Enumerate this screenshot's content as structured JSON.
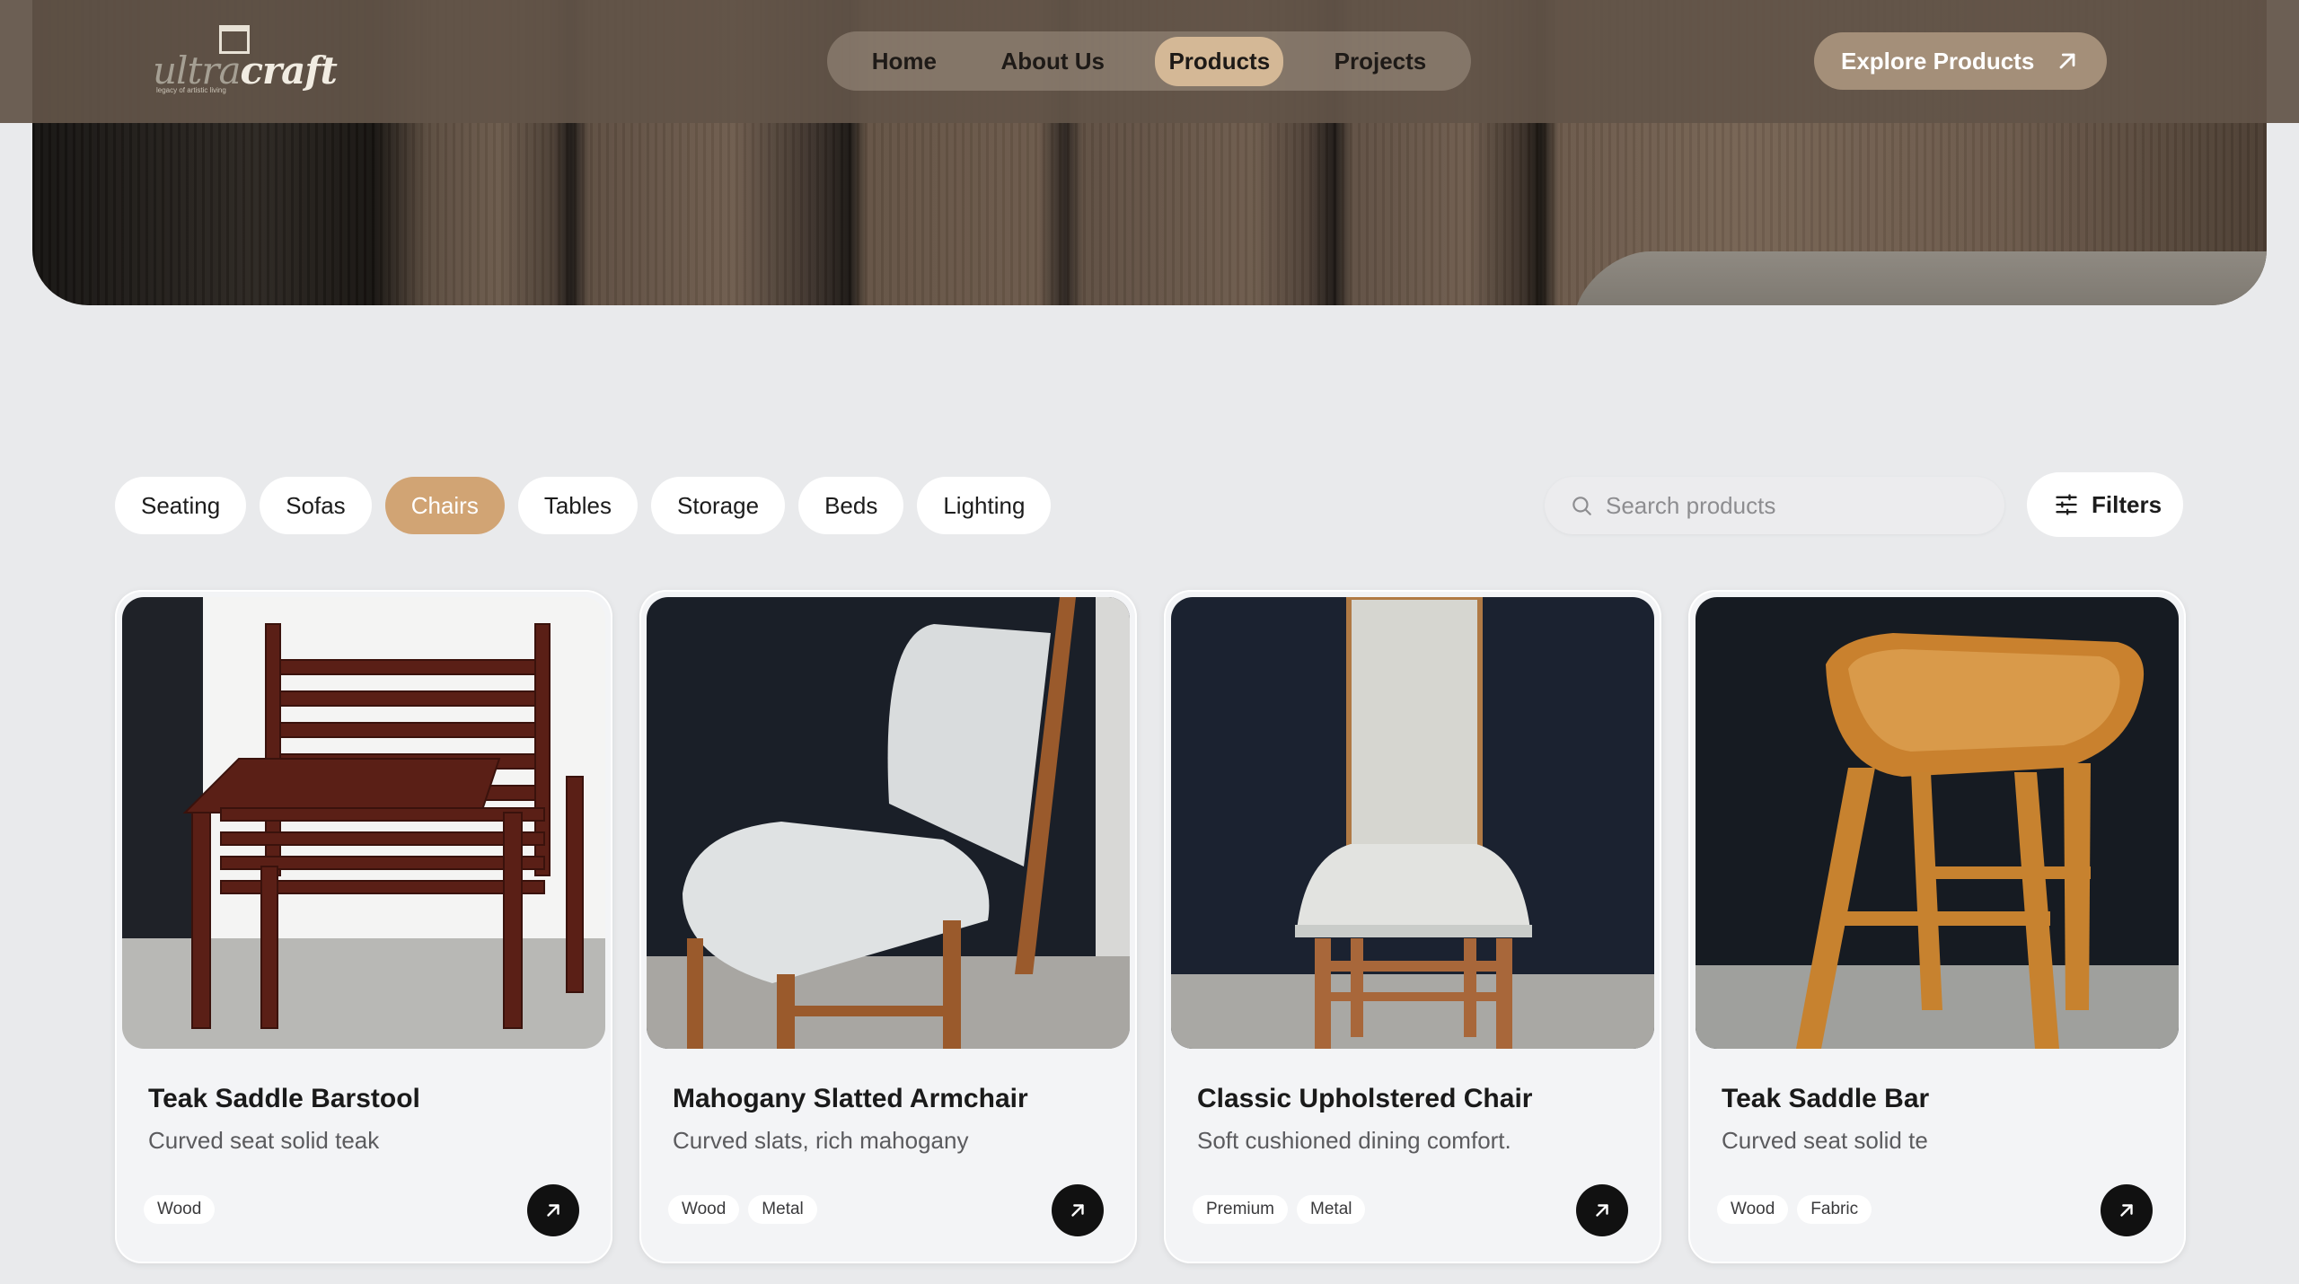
{
  "brand": {
    "logo_text_light": "ultra",
    "logo_text_bold": "craft",
    "logo_tagline": "legacy of artistic living"
  },
  "nav": {
    "items": [
      {
        "label": "Home",
        "active": false
      },
      {
        "label": "About Us",
        "active": false
      },
      {
        "label": "Products",
        "active": true
      },
      {
        "label": "Projects",
        "active": false
      }
    ],
    "cta_label": "Explore Products"
  },
  "categories": [
    {
      "label": "Seating",
      "active": false
    },
    {
      "label": "Sofas",
      "active": false
    },
    {
      "label": "Chairs",
      "active": true
    },
    {
      "label": "Tables",
      "active": false
    },
    {
      "label": "Storage",
      "active": false
    },
    {
      "label": "Beds",
      "active": false
    },
    {
      "label": "Lighting",
      "active": false
    }
  ],
  "search": {
    "placeholder": "Search products"
  },
  "filters_label": "Filters",
  "products": [
    {
      "title": "Teak Saddle Barstool",
      "description": "Curved seat solid teak",
      "tags": [
        "Wood"
      ]
    },
    {
      "title": "Mahogany Slatted Armchair",
      "description": "Curved slats, rich mahogany",
      "tags": [
        "Wood",
        "Metal"
      ]
    },
    {
      "title": "Classic Upholstered Chair",
      "description": "Soft cushioned dining comfort.",
      "tags": [
        "Premium",
        "Metal"
      ]
    },
    {
      "title": "Teak Saddle Bar",
      "description": "Curved seat solid te",
      "tags": [
        "Wood",
        "Fabric"
      ]
    }
  ],
  "colors": {
    "accent_chip": "#d1a474",
    "nav_active": "#d4b896",
    "cta_background": "#a48f79",
    "page_background": "#e9eaec"
  }
}
